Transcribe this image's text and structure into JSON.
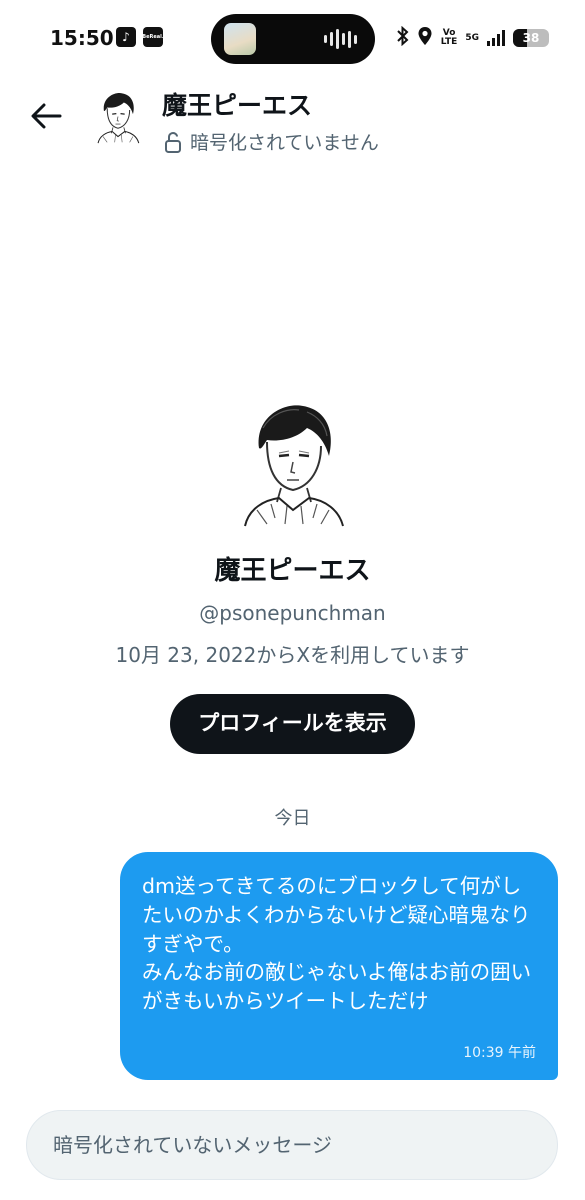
{
  "status_bar": {
    "time": "15:50",
    "apps": [
      {
        "name": "tiktok-icon",
        "glyph": "♪"
      },
      {
        "name": "bereal-icon",
        "glyph": "BeReal."
      }
    ],
    "volte": "Vo\nLTE",
    "network": "5G",
    "battery_percent": 38,
    "battery_label": "38"
  },
  "header": {
    "title": "魔王ピーエス",
    "encryption_status": "暗号化されていません"
  },
  "profile": {
    "name": "魔王ピーエス",
    "handle": "@psonepunchman",
    "joined": "10月 23, 2022からXを利用しています",
    "view_profile_label": "プロフィールを表示"
  },
  "conversation": {
    "day_label": "今日",
    "messages": [
      {
        "direction": "outgoing",
        "text": "dm送ってきてるのにブロックして何がしたいのかよくわからないけど疑心暗鬼なりすぎやで。\nみんなお前の敵じゃないよ俺はお前の囲いがきもいからツイートしただけ",
        "time": "10:39 午前"
      }
    ]
  },
  "composer": {
    "placeholder": "暗号化されていないメッセージ"
  },
  "colors": {
    "accent": "#1d9bf0",
    "text_primary": "#0f1419",
    "text_secondary": "#536471",
    "button_dark": "#0f1419",
    "composer_bg": "#eff3f4"
  }
}
